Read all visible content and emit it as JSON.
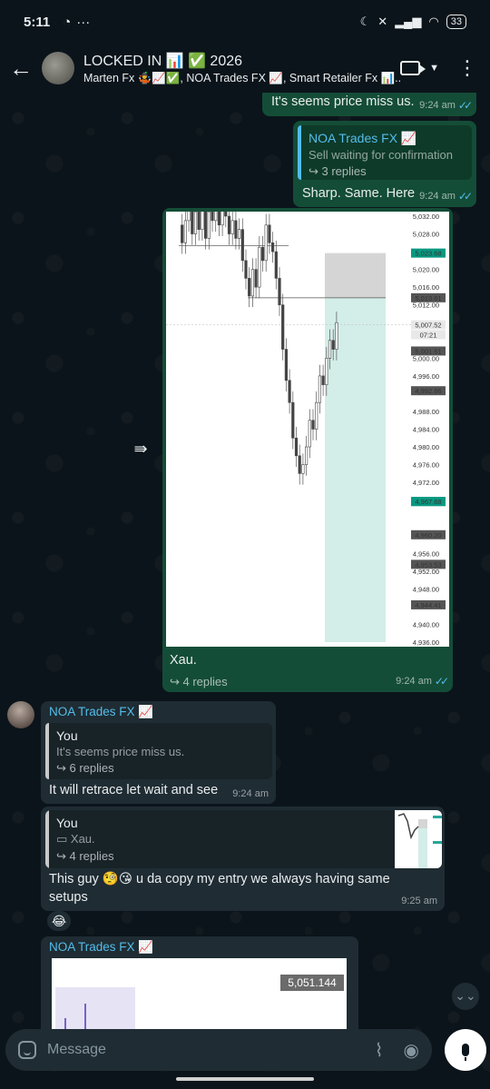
{
  "status_bar": {
    "time": "5:11",
    "battery": "33"
  },
  "header": {
    "title": "LOCKED IN 📊 ✅ 2026",
    "subtitle": "Marten Fx 🤹📈✅, NOA Trades FX 📈, Smart Retailer Fx 📊..."
  },
  "messages": [
    {
      "id": "m1",
      "text": "It's seems price miss us.",
      "time": "9:24 am"
    },
    {
      "id": "m2",
      "quote_author": "NOA Trades FX 📈",
      "quote_text": "Sell waiting for confirmation",
      "quote_replies": "↪ 3 replies",
      "text": "Sharp. Same. Here",
      "time": "9:24 am"
    },
    {
      "id": "m3",
      "caption": "Xau.",
      "replies": "↪ 4 replies",
      "time": "9:24 am"
    },
    {
      "id": "m4",
      "sender": "NOA Trades FX 📈",
      "quote_author": "You",
      "quote_text": "It's seems price miss us.",
      "quote_replies": "↪ 6 replies",
      "text": "It will retrace let wait and see",
      "time": "9:24 am"
    },
    {
      "id": "m5",
      "quote_author": "You",
      "quote_text": "Xau.",
      "quote_replies": "↪ 4 replies",
      "text": "This guy 🧐😘 u da copy my entry we always having same setups",
      "time": "9:25 am",
      "reaction": "😂"
    },
    {
      "id": "m6",
      "sender": "NOA Trades FX 📈",
      "price_tag": "5,051.144"
    }
  ],
  "chart": {
    "axis_ticks": [
      "5,032.00",
      "5,028.00",
      "5,020.00",
      "5,016.00",
      "5,012.00",
      "5,000.00",
      "4,996.00",
      "4,988.00",
      "4,984.00",
      "4,980.00",
      "4,976.00",
      "4,972.00",
      "4,956.00",
      "4,952.00",
      "4,948.00",
      "4,940.00",
      "4,936.00"
    ],
    "price_tags": [
      {
        "label": "5,023.68",
        "kind": "green"
      },
      {
        "label": "5,013.61",
        "kind": "grey"
      },
      {
        "label": "5,007.52",
        "kind": "light"
      },
      {
        "label": "07:21",
        "kind": "light"
      },
      {
        "label": "5,001.61",
        "kind": "grey"
      },
      {
        "label": "4,992.66",
        "kind": "grey"
      },
      {
        "label": "4,967.70",
        "kind": "green"
      },
      {
        "label": "4,967.68",
        "kind": "green"
      },
      {
        "label": "4,960.20",
        "kind": "grey"
      },
      {
        "label": "4,953.53",
        "kind": "grey"
      },
      {
        "label": "4,944.41",
        "kind": "grey"
      }
    ]
  },
  "input": {
    "placeholder": "Message"
  },
  "colors": {
    "outgoing_bubble": "#144d37",
    "incoming_bubble": "#1f2c33",
    "accent": "#53bdeb",
    "tp_zone": "#d3ede8",
    "sl_zone": "#d5d5d5"
  }
}
